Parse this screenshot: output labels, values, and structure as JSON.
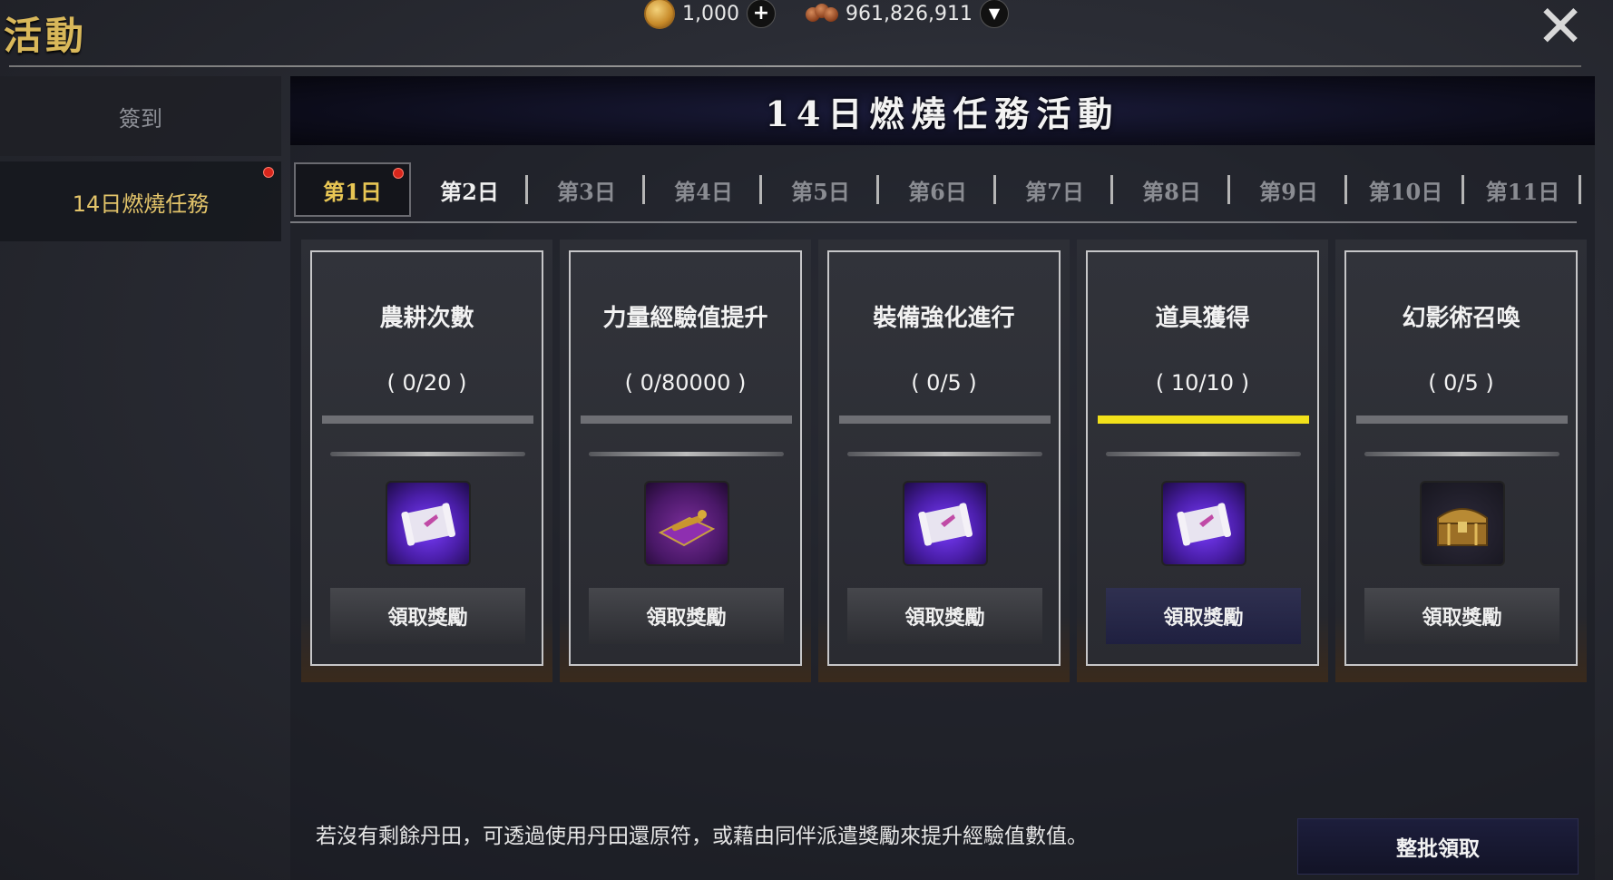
{
  "window": {
    "title": "活動",
    "close_glyph": "✕"
  },
  "currencies": [
    {
      "icon": "gold-coin-icon",
      "value": "1,000",
      "action": "+"
    },
    {
      "icon": "red-beads-icon",
      "value": "961,826,911",
      "action": "▼"
    }
  ],
  "sidebar": {
    "items": [
      {
        "label": "簽到",
        "active": false
      },
      {
        "label": "14日燃燒任務",
        "active": true,
        "has_notification": true
      }
    ]
  },
  "banner": {
    "title": "14日燃燒任務活動"
  },
  "day_tabs": {
    "items": [
      {
        "label": "第1日",
        "selected": true,
        "has_notification": true
      },
      {
        "label": "第2日"
      },
      {
        "label": "第3日"
      },
      {
        "label": "第4日"
      },
      {
        "label": "第5日"
      },
      {
        "label": "第6日"
      },
      {
        "label": "第7日"
      },
      {
        "label": "第8日"
      },
      {
        "label": "第9日"
      },
      {
        "label": "第10日"
      },
      {
        "label": "第11日"
      }
    ]
  },
  "missions": [
    {
      "title": "農耕次數",
      "progress": "( 0/20 )",
      "fill": 0.0,
      "reward_icon": "scroll-icon",
      "button": "領取獎勵",
      "ready": false
    },
    {
      "title": "力量經驗值提升",
      "progress": "( 0/80000 )",
      "fill": 0.0,
      "reward_icon": "scroll-on-cloth-icon",
      "button": "領取獎勵",
      "ready": false
    },
    {
      "title": "裝備強化進行",
      "progress": "( 0/5 )",
      "fill": 0.0,
      "reward_icon": "scroll-icon",
      "button": "領取獎勵",
      "ready": false
    },
    {
      "title": "道具獲得",
      "progress": "( 10/10 )",
      "fill": 1.0,
      "reward_icon": "scroll-icon",
      "button": "領取獎勵",
      "ready": true
    },
    {
      "title": "幻影術召喚",
      "progress": "( 0/5 )",
      "fill": 0.0,
      "reward_icon": "treasure-chest-icon",
      "button": "領取獎勵",
      "ready": false
    }
  ],
  "footer": {
    "note": "若沒有剩餘丹田，可透過使用丹田還原符，或藉由同伴派遣獎勵來提升經驗值數值。",
    "batch_button": "整批領取"
  },
  "colors": {
    "accent_gold": "#d9b85a",
    "progress_yellow": "#f2e11a",
    "notification_red": "#d8261c"
  }
}
